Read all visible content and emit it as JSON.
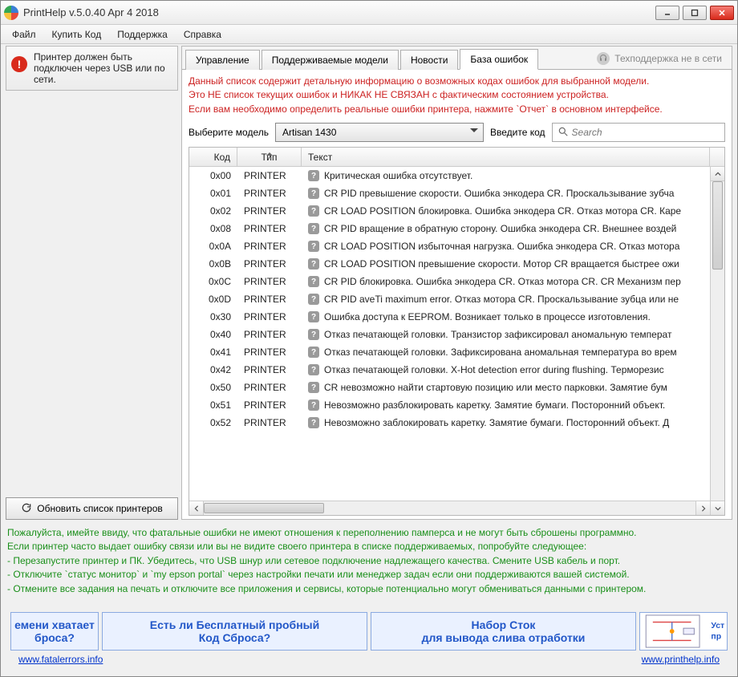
{
  "window": {
    "title": "PrintHelp v.5.0.40 Apr  4 2018"
  },
  "menu": {
    "items": [
      "Файл",
      "Купить Код",
      "Поддержка",
      "Справка"
    ]
  },
  "left": {
    "warning": "Принтер должен быть подключен через USB или по сети.",
    "refresh_label": "Обновить список принтеров"
  },
  "tabs": {
    "items": [
      "Управление",
      "Поддерживаемые модели",
      "Новости",
      "База ошибок"
    ],
    "active_index": 3
  },
  "support_status": "Техподдержка не в сети",
  "notice": {
    "line1": "Данный список содержит детальную информацию о возможных кодах ошибок для выбранной модели.",
    "line2": "Это НЕ список текущих ошибок и НИКАК НЕ СВЯЗАН с фактическим состоянием устройства.",
    "line3": "Если вам необходимо определить реальные ошибки принтера, нажмите `Отчет` в основном интерфейсе."
  },
  "model_row": {
    "label": "Выберите модель",
    "selected": "Artisan 1430",
    "code_label": "Введите код",
    "search_placeholder": "Search"
  },
  "table": {
    "headers": {
      "code": "Код",
      "type": "Тип",
      "text": "Текст"
    },
    "rows": [
      {
        "code": "0x00",
        "type": "PRINTER",
        "text": "Критическая ошибка отсутствует."
      },
      {
        "code": "0x01",
        "type": "PRINTER",
        "text": "CR PID превышение скорости. Ошибка энкодера CR. Проскальзывание зубча"
      },
      {
        "code": "0x02",
        "type": "PRINTER",
        "text": "CR LOAD POSITION блокировка. Ошибка энкодера CR. Отказ мотора CR. Каре"
      },
      {
        "code": "0x08",
        "type": "PRINTER",
        "text": "CR PID вращение в обратную сторону. Ошибка энкодера CR. Внешнее воздей"
      },
      {
        "code": "0x0A",
        "type": "PRINTER",
        "text": "CR LOAD POSITION избыточная нагрузка. Ошибка энкодера CR. Отказ мотора"
      },
      {
        "code": "0x0B",
        "type": "PRINTER",
        "text": "CR LOAD POSITION превышение скорости. Мотор CR вращается быстрее ожи"
      },
      {
        "code": "0x0C",
        "type": "PRINTER",
        "text": "CR PID блокировка. Ошибка энкодера CR. Отказ мотора CR. CR Механизм пер"
      },
      {
        "code": "0x0D",
        "type": "PRINTER",
        "text": "CR PID aveTi maximum error. Отказ мотора CR. Проскальзывание зубца или не"
      },
      {
        "code": "0x30",
        "type": "PRINTER",
        "text": "Ошибка доступа к EEPROM. Возникает только в процессе изготовления."
      },
      {
        "code": "0x40",
        "type": "PRINTER",
        "text": "Отказ печатающей головки. Транзистор зафиксировал аномальную температ"
      },
      {
        "code": "0x41",
        "type": "PRINTER",
        "text": "Отказ печатающей головки. Зафиксирована аномальная температура во врем"
      },
      {
        "code": "0x42",
        "type": "PRINTER",
        "text": "Отказ печатающей головки. X-Hot detection error during flushing. Терморезис"
      },
      {
        "code": "0x50",
        "type": "PRINTER",
        "text": "CR невозможно найти стартовую позицию или место парковки. Замятие бум"
      },
      {
        "code": "0x51",
        "type": "PRINTER",
        "text": "Невозможно разблокировать каретку. Замятие бумаги. Посторонний объект. "
      },
      {
        "code": "0x52",
        "type": "PRINTER",
        "text": "Невозможно заблокировать каретку. Замятие бумаги. Посторонний объект. Д"
      }
    ]
  },
  "help": {
    "line1": "Пожалуйста, имейте ввиду, что фатальные ошибки не имеют отношения к переполнению памперса и не могут быть сброшены программно.",
    "line2": "Если принтер часто выдает ошибку связи или вы не видите своего принтера в списке поддерживаемых, попробуйте следующее:",
    "line3": "- Перезапустите принтер и ПК. Убедитесь, что USB шнур или сетевое подключение надлежащего качества. Смените USB кабель и порт.",
    "line4": "- Отключите `статус монитор` и `my epson portal` через настройки печати или менеджер задач если они поддерживаются вашей системой.",
    "line5": "- Отмените все задания на печать и отключите все приложения и сервисы, которые потенциально могут обмениваться данными с принтером."
  },
  "banners": {
    "b0": "емени хватает\nброса?",
    "b1": "Есть ли Бесплатный пробный\nКод Сброса?",
    "b2": "Набор Сток\nдля вывода слива отработки",
    "b3_alt": "Устро\nпр"
  },
  "links": {
    "left": "www.fatalerrors.info",
    "right": "www.printhelp.info"
  }
}
